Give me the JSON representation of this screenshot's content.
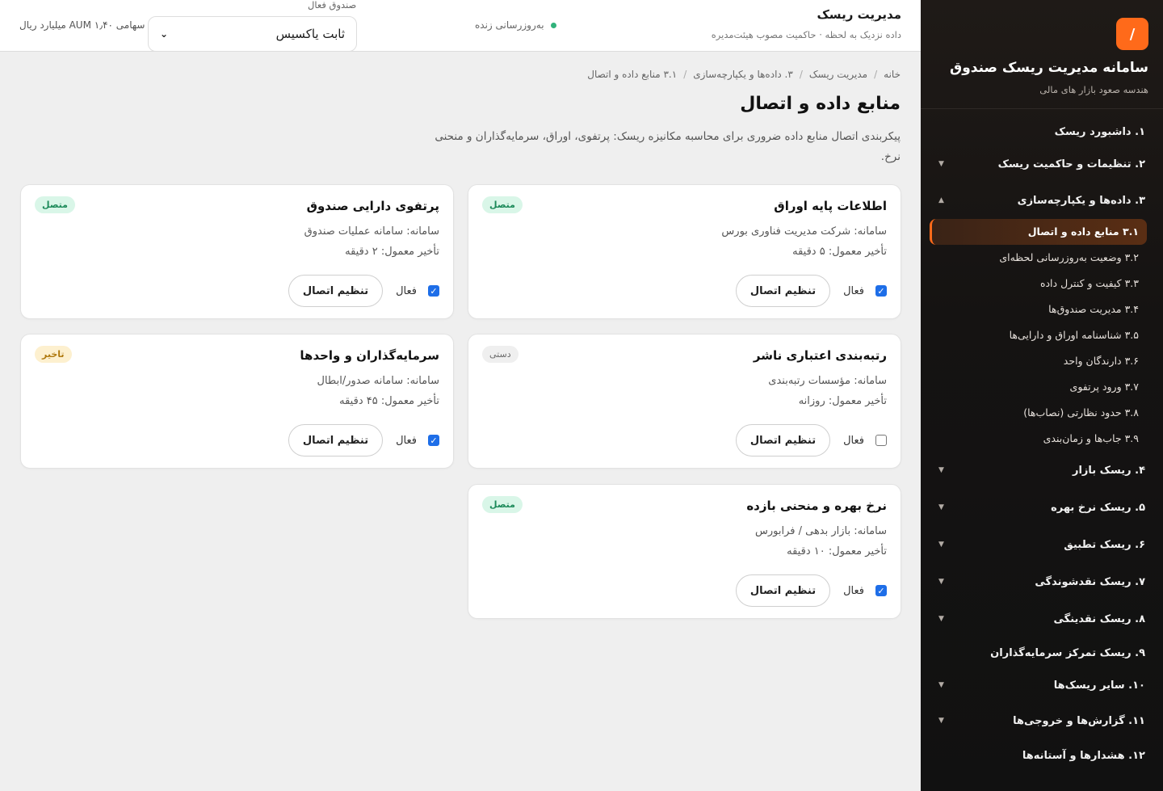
{
  "app": {
    "logo_symbol": "/",
    "title": "سامانه مدیریت ریسک صندوق",
    "subtitle": "هندسه صعود بازار های مالی"
  },
  "topbar": {
    "title": "مدیریت ریسک",
    "subtitle": "داده نزدیک به لحظه · حاکمیت مصوب هیئت‌مدیره",
    "live_text": "به‌روزرسانی زنده",
    "fund_label": "صندوق فعال",
    "fund_value": "ثابت یاکسیس",
    "aum_text": "سهامی AUM ۱٫۴۰ میلیارد ریال"
  },
  "breadcrumb": [
    "خانه",
    "مدیریت ریسک",
    "۳. داده‌ها و یکپارچه‌سازی",
    "۳.۱ منابع داده و اتصال"
  ],
  "page": {
    "title": "منابع داده و اتصال",
    "description": "پیکربندی اتصال منابع داده ضروری برای محاسبه مکانیزه ریسک: پرتفوی، اوراق، سرمایه‌گذاران و منحنی نرخ."
  },
  "sidebar": {
    "items": [
      {
        "label": "۱. داشبورد ریسک",
        "has_chevron": false
      },
      {
        "label": "۲. تنظیمات و حاکمیت ریسک",
        "chevron": "▼"
      },
      {
        "label": "۳. داده‌ها و یکپارچه‌سازی",
        "chevron": "▲"
      },
      {
        "label": "۴. ریسک بازار",
        "chevron": "▼"
      },
      {
        "label": "۵. ریسک نرخ بهره",
        "chevron": "▼"
      },
      {
        "label": "۶. ریسک تطبیق",
        "chevron": "▼"
      },
      {
        "label": "۷. ریسک نقدشوندگی",
        "chevron": "▼"
      },
      {
        "label": "۸. ریسک نقدینگی",
        "chevron": "▼"
      },
      {
        "label": "۹. ریسک تمرکز سرمایه‌گذاران",
        "has_chevron": false
      },
      {
        "label": "۱۰. سایر ریسک‌ها",
        "chevron": "▼"
      },
      {
        "label": "۱۱. گزارش‌ها و خروجی‌ها",
        "chevron": "▼"
      },
      {
        "label": "۱۲. هشدارها و آستانه‌ها",
        "has_chevron": false
      }
    ],
    "sub_items": [
      "۳.۱ منابع داده و اتصال",
      "۳.۲ وضعیت به‌روزرسانی لحظه‌ای",
      "۳.۳ کیفیت و کنترل داده",
      "۳.۴ مدیریت صندوق‌ها",
      "۳.۵ شناسنامه اوراق و دارایی‌ها",
      "۳.۶ دارندگان واحد",
      "۳.۷ ورود پرتفوی",
      "۳.۸ حدود نظارتی (نصاب‌ها)",
      "۳.۹ جاب‌ها و زمان‌بندی"
    ]
  },
  "cards": [
    {
      "title": "اطلاعات پایه اوراق",
      "status": "متصل",
      "status_kind": "ok",
      "system": "سامانه: شرکت مدیریت فناوری بورس",
      "delay": "تأخیر معمول: ۵ دقیقه",
      "enabled_label": "فعال",
      "enabled": true,
      "button": "تنظیم اتصال"
    },
    {
      "title": "پرتفوی دارایی صندوق",
      "status": "متصل",
      "status_kind": "ok",
      "system": "سامانه: سامانه عملیات صندوق",
      "delay": "تأخیر معمول: ۲ دقیقه",
      "enabled_label": "فعال",
      "enabled": true,
      "button": "تنظیم اتصال"
    },
    {
      "title": "رتبه‌بندی اعتباری ناشر",
      "status": "دستی",
      "status_kind": "manual",
      "system": "سامانه: مؤسسات رتبه‌بندی",
      "delay": "تأخیر معمول: روزانه",
      "enabled_label": "فعال",
      "enabled": false,
      "button": "تنظیم اتصال"
    },
    {
      "title": "سرمایه‌گذاران و واحدها",
      "status": "تاخیر",
      "status_kind": "late",
      "system": "سامانه: سامانه صدور/ابطال",
      "delay": "تأخیر معمول: ۴۵ دقیقه",
      "enabled_label": "فعال",
      "enabled": true,
      "button": "تنظیم اتصال"
    },
    {
      "title": "نرخ بهره و منحنی بازده",
      "status": "متصل",
      "status_kind": "ok",
      "system": "سامانه: بازار بدهی / فرابورس",
      "delay": "تأخیر معمول: ۱۰ دقیقه",
      "enabled_label": "فعال",
      "enabled": true,
      "button": "تنظیم اتصال"
    }
  ],
  "colors": {
    "accent": "#ff6a1a",
    "status_ok": "#1d8a5a",
    "status_late": "#b07a10",
    "checkbox": "#1e6ee8",
    "live_dot": "#31b27b"
  }
}
